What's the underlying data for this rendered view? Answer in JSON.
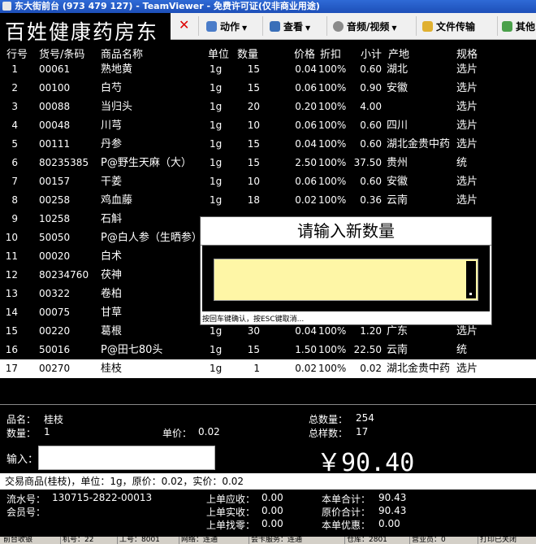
{
  "window": {
    "title": "东大街前台 (973 479 127) - TeamViewer - 免费许可证(仅非商业用途)"
  },
  "header": {
    "store_name": "百姓健康药房东"
  },
  "teamviewer_bar": {
    "actions": "动作",
    "view": "查看",
    "audio_video": "音频/视频",
    "file_transfer": "文件传输",
    "more": "其他"
  },
  "table": {
    "columns": [
      "行号",
      "货号/条码",
      "商品名称",
      "单位",
      "数量",
      "价格",
      "折扣",
      "小计",
      "产地",
      "规格"
    ],
    "rows": [
      {
        "no": "1",
        "code": "00061",
        "name": "熟地黄",
        "unit": "1g",
        "qty": "15",
        "price": "0.04",
        "disc": "100%",
        "sub": "0.60",
        "origin": "湖北",
        "spec": "选片"
      },
      {
        "no": "2",
        "code": "00100",
        "name": "白芍",
        "unit": "1g",
        "qty": "15",
        "price": "0.06",
        "disc": "100%",
        "sub": "0.90",
        "origin": "安徽",
        "spec": "选片"
      },
      {
        "no": "3",
        "code": "00088",
        "name": "当归头",
        "unit": "1g",
        "qty": "20",
        "price": "0.20",
        "disc": "100%",
        "sub": "4.00",
        "origin": "",
        "spec": "选片"
      },
      {
        "no": "4",
        "code": "00048",
        "name": "川芎",
        "unit": "1g",
        "qty": "10",
        "price": "0.06",
        "disc": "100%",
        "sub": "0.60",
        "origin": "四川",
        "spec": "选片"
      },
      {
        "no": "5",
        "code": "00111",
        "name": "丹参",
        "unit": "1g",
        "qty": "15",
        "price": "0.04",
        "disc": "100%",
        "sub": "0.60",
        "origin": "湖北金贵中药",
        "spec": "选片"
      },
      {
        "no": "6",
        "code": "80235385",
        "name": "P@野生天麻（大）",
        "unit": "1g",
        "qty": "15",
        "price": "2.50",
        "disc": "100%",
        "sub": "37.50",
        "origin": "贵州",
        "spec": "统"
      },
      {
        "no": "7",
        "code": "00157",
        "name": "干姜",
        "unit": "1g",
        "qty": "10",
        "price": "0.06",
        "disc": "100%",
        "sub": "0.60",
        "origin": "安徽",
        "spec": "选片"
      },
      {
        "no": "8",
        "code": "00258",
        "name": "鸡血藤",
        "unit": "1g",
        "qty": "18",
        "price": "0.02",
        "disc": "100%",
        "sub": "0.36",
        "origin": "云南",
        "spec": "选片"
      },
      {
        "no": "9",
        "code": "10258",
        "name": "石斛",
        "unit": "",
        "qty": "",
        "price": "",
        "disc": "",
        "sub": "",
        "origin": "",
        "spec": ""
      },
      {
        "no": "10",
        "code": "50050",
        "name": "P@白人参（生晒参）",
        "unit": "",
        "qty": "",
        "price": "",
        "disc": "",
        "sub": "",
        "origin": "",
        "spec": ""
      },
      {
        "no": "11",
        "code": "00020",
        "name": "白术",
        "unit": "",
        "qty": "",
        "price": "",
        "disc": "",
        "sub": "",
        "origin": "",
        "spec": ""
      },
      {
        "no": "12",
        "code": "80234760",
        "name": "茯神",
        "unit": "",
        "qty": "",
        "price": "",
        "disc": "",
        "sub": "",
        "origin": "",
        "spec": ""
      },
      {
        "no": "13",
        "code": "00322",
        "name": "卷柏",
        "unit": "",
        "qty": "",
        "price": "",
        "disc": "",
        "sub": "",
        "origin": "",
        "spec": ""
      },
      {
        "no": "14",
        "code": "00075",
        "name": "甘草",
        "unit": "",
        "qty": "",
        "price": "",
        "disc": "",
        "sub": "",
        "origin": "",
        "spec": ""
      },
      {
        "no": "15",
        "code": "00220",
        "name": "葛根",
        "unit": "1g",
        "qty": "30",
        "price": "0.04",
        "disc": "100%",
        "sub": "1.20",
        "origin": "广东",
        "spec": "选片"
      },
      {
        "no": "16",
        "code": "50016",
        "name": "P@田七80头",
        "unit": "1g",
        "qty": "15",
        "price": "1.50",
        "disc": "100%",
        "sub": "22.50",
        "origin": "云南",
        "spec": "统"
      },
      {
        "no": "17",
        "code": "00270",
        "name": "桂枝",
        "unit": "1g",
        "qty": "1",
        "price": "0.02",
        "disc": "100%",
        "sub": "0.02",
        "origin": "湖北金贵中药",
        "spec": "选片"
      }
    ]
  },
  "detail": {
    "name_label": "品名：",
    "name_value": "桂枝",
    "qty_label": "数量：",
    "qty_value": "1",
    "unit_price_label": "单价：",
    "unit_price_value": "0.02",
    "total_qty_label": "总数量：",
    "total_qty_value": "254",
    "total_kinds_label": "总样数：",
    "total_kinds_value": "17"
  },
  "input": {
    "label": "输入：",
    "total": "￥90.40"
  },
  "trade_line": "交易商品(桂枝)，单位：1g，原价：0.02，实价：0.02",
  "footer": {
    "serial_label": "流水号：",
    "serial_value": "130715-2822-00013",
    "member_label": "会员号：",
    "prev_due_label": "上单应收：",
    "prev_due_value": "0.00",
    "prev_paid_label": "上单实收：",
    "prev_paid_value": "0.00",
    "prev_change_label": "上单找零：",
    "prev_change_value": "0.00",
    "cur_total_label": "本单合计：",
    "cur_total_value": "90.43",
    "orig_total_label": "原价合计：",
    "orig_total_value": "90.43",
    "cur_discount_label": "本单优惠：",
    "cur_discount_value": "0.00"
  },
  "statusbar": [
    "前台收银",
    "机号：22",
    "工号：8001",
    "网络：连通",
    "会卡服务：连通",
    "仓库：2801",
    "营业员：0",
    "打印已关闭"
  ],
  "dialog": {
    "title": "请输入新数量",
    "hint": "按回车键确认，按ESC键取消..."
  }
}
